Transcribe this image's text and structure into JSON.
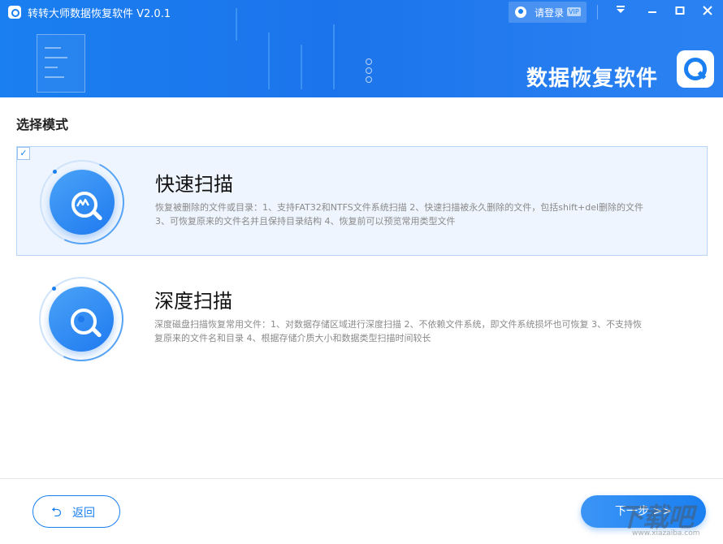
{
  "window": {
    "title": "转转大师数据恢复软件 V2.0.1",
    "login_label": "请登录",
    "vip_badge": "VIP",
    "controls": [
      "dropdown-icon",
      "minimize-icon",
      "maximize-icon",
      "close-icon"
    ]
  },
  "banner": {
    "text": "数据恢复软件"
  },
  "colors": {
    "accent": "#1a7ff0",
    "selected_bg": "#eef5fe",
    "selected_border": "#b6d5f7"
  },
  "section_title": "选择模式",
  "modes": [
    {
      "title": "快速扫描",
      "selected": true,
      "icon": "quick-scan-icon",
      "description": "恢复被删除的文件或目录：1、支持FAT32和NTFS文件系统扫描 2、快速扫描被永久删除的文件，包括shift+del删除的文件 3、可恢复原来的文件名并且保持目录结构 4、恢复前可以预览常用类型文件"
    },
    {
      "title": "深度扫描",
      "selected": false,
      "icon": "deep-scan-icon",
      "description": "深度磁盘扫描恢复常用文件：1、对数据存储区域进行深度扫描 2、不依赖文件系统，即文件系统损坏也可恢复 3、不支持恢复原来的文件名和目录 4、根据存储介质大小和数据类型扫描时间较长"
    }
  ],
  "footer": {
    "back_label": "返回",
    "next_label": "下一步 >>"
  },
  "watermark": {
    "main": "下载吧",
    "sub": "www.xiazaiba.com"
  }
}
